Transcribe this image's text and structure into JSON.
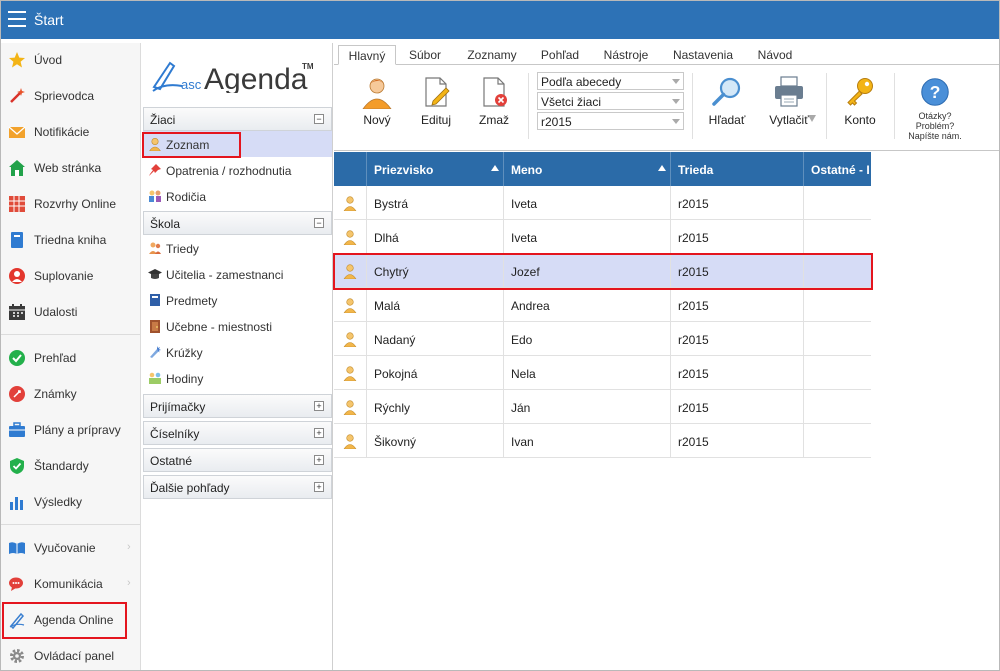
{
  "app": {
    "title": "Štart"
  },
  "sidebar": {
    "items": [
      {
        "label": "Úvod",
        "icon": "star-icon"
      },
      {
        "label": "Sprievodca",
        "icon": "magic-wand-icon"
      },
      {
        "label": "Notifikácie",
        "icon": "envelope-icon"
      },
      {
        "label": "Web stránka",
        "icon": "house-icon"
      },
      {
        "label": "Rozvrhy Online",
        "icon": "timetable-icon"
      },
      {
        "label": "Triedna kniha",
        "icon": "book-icon"
      },
      {
        "label": "Suplovanie",
        "icon": "substitute-icon"
      },
      {
        "label": "Udalosti",
        "icon": "calendar-icon"
      },
      {
        "label": "Prehľad",
        "icon": "check-circle-icon"
      },
      {
        "label": "Známky",
        "icon": "grades-icon"
      },
      {
        "label": "Plány a prípravy",
        "icon": "briefcase-icon"
      },
      {
        "label": "Štandardy",
        "icon": "shield-check-icon"
      },
      {
        "label": "Výsledky",
        "icon": "bar-chart-icon"
      },
      {
        "label": "Vyučovanie",
        "icon": "open-book-icon"
      },
      {
        "label": "Komunikácia",
        "icon": "chat-icon"
      },
      {
        "label": "Agenda Online",
        "icon": "pen-icon"
      },
      {
        "label": "Ovládací panel",
        "icon": "gear-icon"
      }
    ]
  },
  "agenda": {
    "logo_prefix": "asc",
    "logo_text": "Agenda",
    "logo_tm": "TM",
    "sections": {
      "ziaci": {
        "label": "Žiaci",
        "toggle": "−"
      },
      "skola": {
        "label": "Škola",
        "toggle": "−"
      },
      "prijimacky": {
        "label": "Prijímačky",
        "toggle": "+"
      },
      "ciselniky": {
        "label": "Číselníky",
        "toggle": "+"
      },
      "ostatne": {
        "label": "Ostatné",
        "toggle": "+"
      },
      "dalsie": {
        "label": "Ďalšie pohľady",
        "toggle": "+"
      }
    },
    "ziaci_items": [
      {
        "label": "Zoznam",
        "icon": "student-icon"
      },
      {
        "label": "Opatrenia / rozhodnutia",
        "icon": "pin-icon"
      },
      {
        "label": "Rodičia",
        "icon": "parents-icon"
      }
    ],
    "skola_items": [
      {
        "label": "Triedy",
        "icon": "class-icon"
      },
      {
        "label": "Učitelia - zamestnanci",
        "icon": "graduation-cap-icon"
      },
      {
        "label": "Predmety",
        "icon": "subject-icon"
      },
      {
        "label": "Učebne - miestnosti",
        "icon": "door-icon"
      },
      {
        "label": "Krúžky",
        "icon": "club-icon"
      },
      {
        "label": "Hodiny",
        "icon": "lessons-icon"
      }
    ]
  },
  "ribbon": {
    "tabs": [
      "Hlavný",
      "Súbor",
      "Zoznamy",
      "Pohľad",
      "Nástroje",
      "Nastavenia",
      "Návod"
    ],
    "new_label": "Nový",
    "edit_label": "Edituj",
    "delete_label": "Zmaž",
    "sort_select": "Podľa abecedy",
    "filter_select": "Všetci žiaci",
    "class_select": "r2015",
    "search_label": "Hľadať",
    "print_label": "Vytlačiť",
    "account_label": "Konto",
    "help_line1": "Otázky?",
    "help_line2": "Problém?",
    "help_line3": "Napíšte nám."
  },
  "grid": {
    "columns": [
      "Priezvisko",
      "Meno",
      "Trieda",
      "Ostatné - I"
    ],
    "rows": [
      {
        "priezvisko": "Bystrá",
        "meno": "Iveta",
        "trieda": "r2015"
      },
      {
        "priezvisko": "Dlhá",
        "meno": "Iveta",
        "trieda": "r2015"
      },
      {
        "priezvisko": "Chytrý",
        "meno": "Jozef",
        "trieda": "r2015"
      },
      {
        "priezvisko": "Malá",
        "meno": "Andrea",
        "trieda": "r2015"
      },
      {
        "priezvisko": "Nadaný",
        "meno": "Edo",
        "trieda": "r2015"
      },
      {
        "priezvisko": "Pokojná",
        "meno": "Nela",
        "trieda": "r2015"
      },
      {
        "priezvisko": "Rýchly",
        "meno": "Ján",
        "trieda": "r2015"
      },
      {
        "priezvisko": "Šikovný",
        "meno": "Ivan",
        "trieda": "r2015"
      }
    ],
    "selected_row": 2
  },
  "colors": {
    "topbar": "#2d72b6",
    "grid_header": "#2b6ba8",
    "selection": "#d6dcf6",
    "highlight": "#e4151e"
  }
}
